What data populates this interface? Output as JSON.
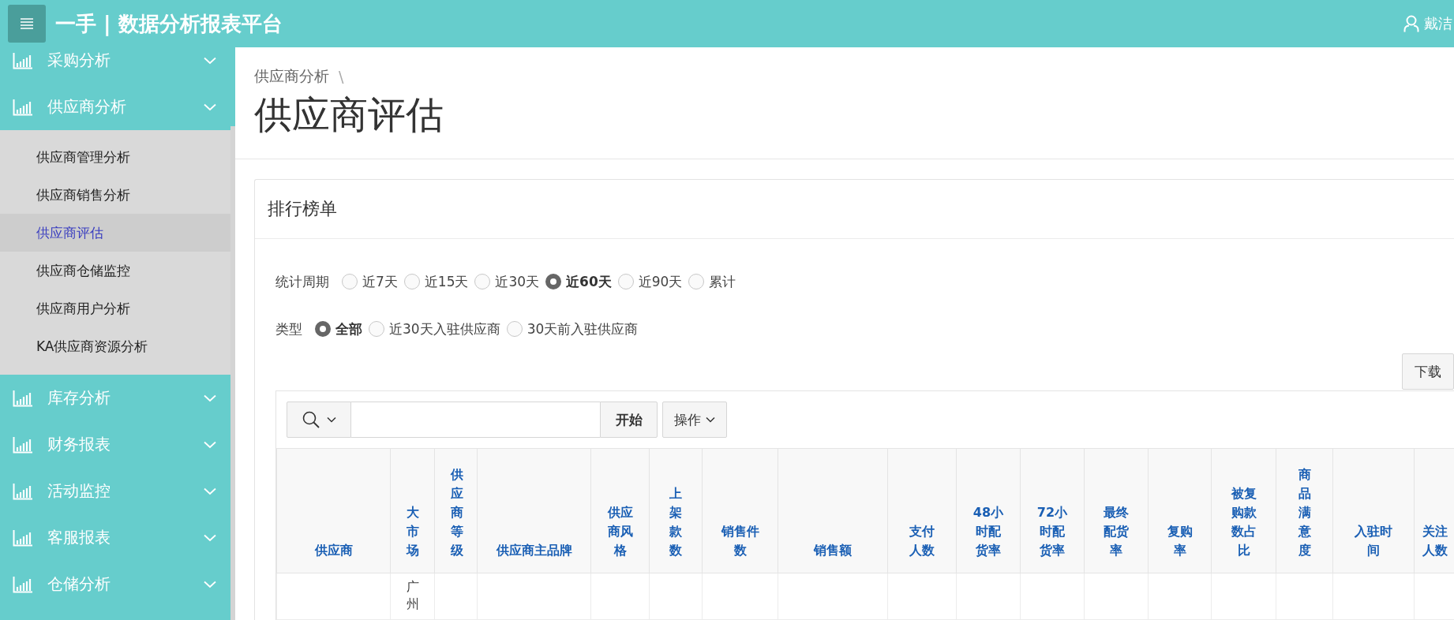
{
  "app": {
    "title": "一手 | 数据分析报表平台",
    "user": "戴洁"
  },
  "sidebar": {
    "items": [
      {
        "label": "采购分析"
      },
      {
        "label": "供应商分析",
        "expanded": true,
        "children": [
          {
            "label": "供应商管理分析",
            "selected": false
          },
          {
            "label": "供应商销售分析",
            "selected": false
          },
          {
            "label": "供应商评估",
            "selected": true
          },
          {
            "label": "供应商仓储监控",
            "selected": false
          },
          {
            "label": "供应商用户分析",
            "selected": false
          },
          {
            "label": "KA供应商资源分析",
            "selected": false
          }
        ]
      },
      {
        "label": "库存分析"
      },
      {
        "label": "财务报表"
      },
      {
        "label": "活动监控"
      },
      {
        "label": "客服报表"
      },
      {
        "label": "仓储分析"
      }
    ]
  },
  "breadcrumb": {
    "items": [
      "供应商分析"
    ],
    "separator": "\\"
  },
  "page_title": "供应商评估",
  "card": {
    "title": "排行榜单",
    "filters": [
      {
        "label": "统计周期",
        "options": [
          {
            "label": "近7天",
            "selected": false
          },
          {
            "label": "近15天",
            "selected": false
          },
          {
            "label": "近30天",
            "selected": false
          },
          {
            "label": "近60天",
            "selected": true
          },
          {
            "label": "近90天",
            "selected": false
          },
          {
            "label": "累计",
            "selected": false
          }
        ]
      },
      {
        "label": "类型",
        "options": [
          {
            "label": "全部",
            "selected": true
          },
          {
            "label": "近30天入驻供应商",
            "selected": false
          },
          {
            "label": "30天前入驻供应商",
            "selected": false
          }
        ]
      }
    ],
    "download_button": "下载",
    "toolbar": {
      "go_button": "开始",
      "actions_button": "操作"
    },
    "table": {
      "columns": [
        "供应商",
        "大市场",
        "供应商等级",
        "供应商主品牌",
        "供应商风格",
        "上架款数",
        "销售件数",
        "销售额",
        "支付人数",
        "48小时配货率",
        "72小时配货率",
        "最终配货率",
        "复购率",
        "被复购款数占比",
        "商品满意度",
        "入驻时间",
        "关注人数"
      ],
      "rows": [
        {
          "market": "广州"
        }
      ]
    }
  }
}
